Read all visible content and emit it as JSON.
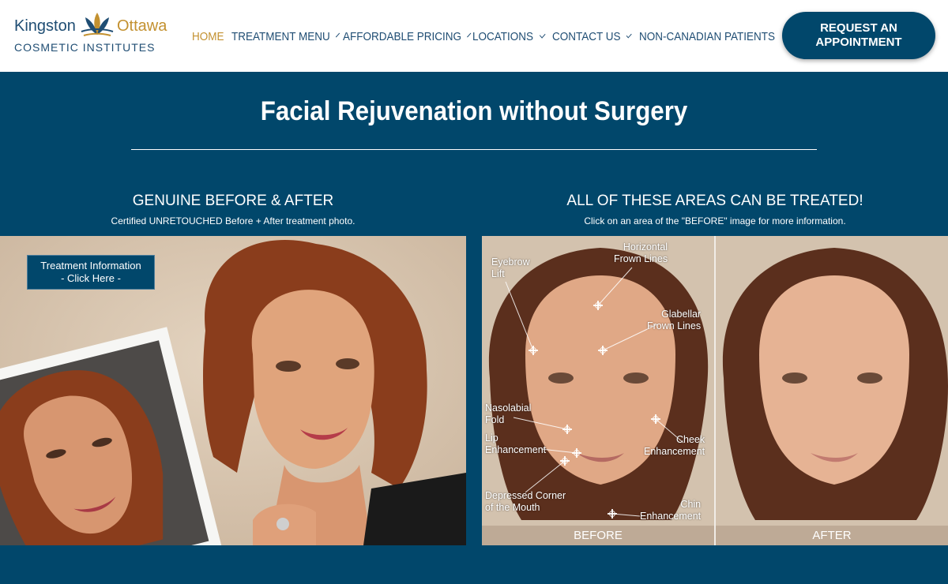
{
  "brand": {
    "kingston": "Kingston",
    "ottawa": "Ottawa",
    "subtitle": "COSMETIC INSTITUTES",
    "colors": {
      "navy": "#01476b",
      "gold": "#c39130"
    }
  },
  "nav": {
    "items": [
      {
        "label": "HOME",
        "active": true,
        "dropdown": false
      },
      {
        "label": "TREATMENT MENU",
        "active": false,
        "dropdown": true
      },
      {
        "label": "AFFORDABLE PRICING",
        "active": false,
        "dropdown": true
      },
      {
        "label": "LOCATIONS",
        "active": false,
        "dropdown": true
      },
      {
        "label": "CONTACT US",
        "active": false,
        "dropdown": true
      },
      {
        "label": "NON-CANADIAN PATIENTS",
        "active": false,
        "dropdown": false
      }
    ],
    "cta_line1": "REQUEST AN",
    "cta_line2": "APPOINTMENT"
  },
  "main": {
    "title": "Facial Rejuvenation without Surgery",
    "left": {
      "heading": "GENUINE BEFORE & AFTER",
      "subheading": "Certified UNRETOUCHED Before + After treatment photo.",
      "button_line1": "Treatment Information",
      "button_line2": "- Click Here -"
    },
    "right": {
      "heading": "ALL OF THESE AREAS CAN BE TREATED!",
      "subheading": "Click on an area of the \"BEFORE\" image for more information.",
      "areas": [
        {
          "label": "Eyebrow\nLift"
        },
        {
          "label": "Horizontal\nFrown Lines"
        },
        {
          "label": "Glabellar\nFrown Lines"
        },
        {
          "label": "Nasolabial\nFold"
        },
        {
          "label": "Lip\nEnhancement"
        },
        {
          "label": "Cheek\nEnhancement"
        },
        {
          "label": "Depressed Corner\nof the Mouth"
        },
        {
          "label": "Chin\nEnhancement"
        }
      ],
      "before_label": "BEFORE",
      "after_label": "AFTER"
    }
  }
}
